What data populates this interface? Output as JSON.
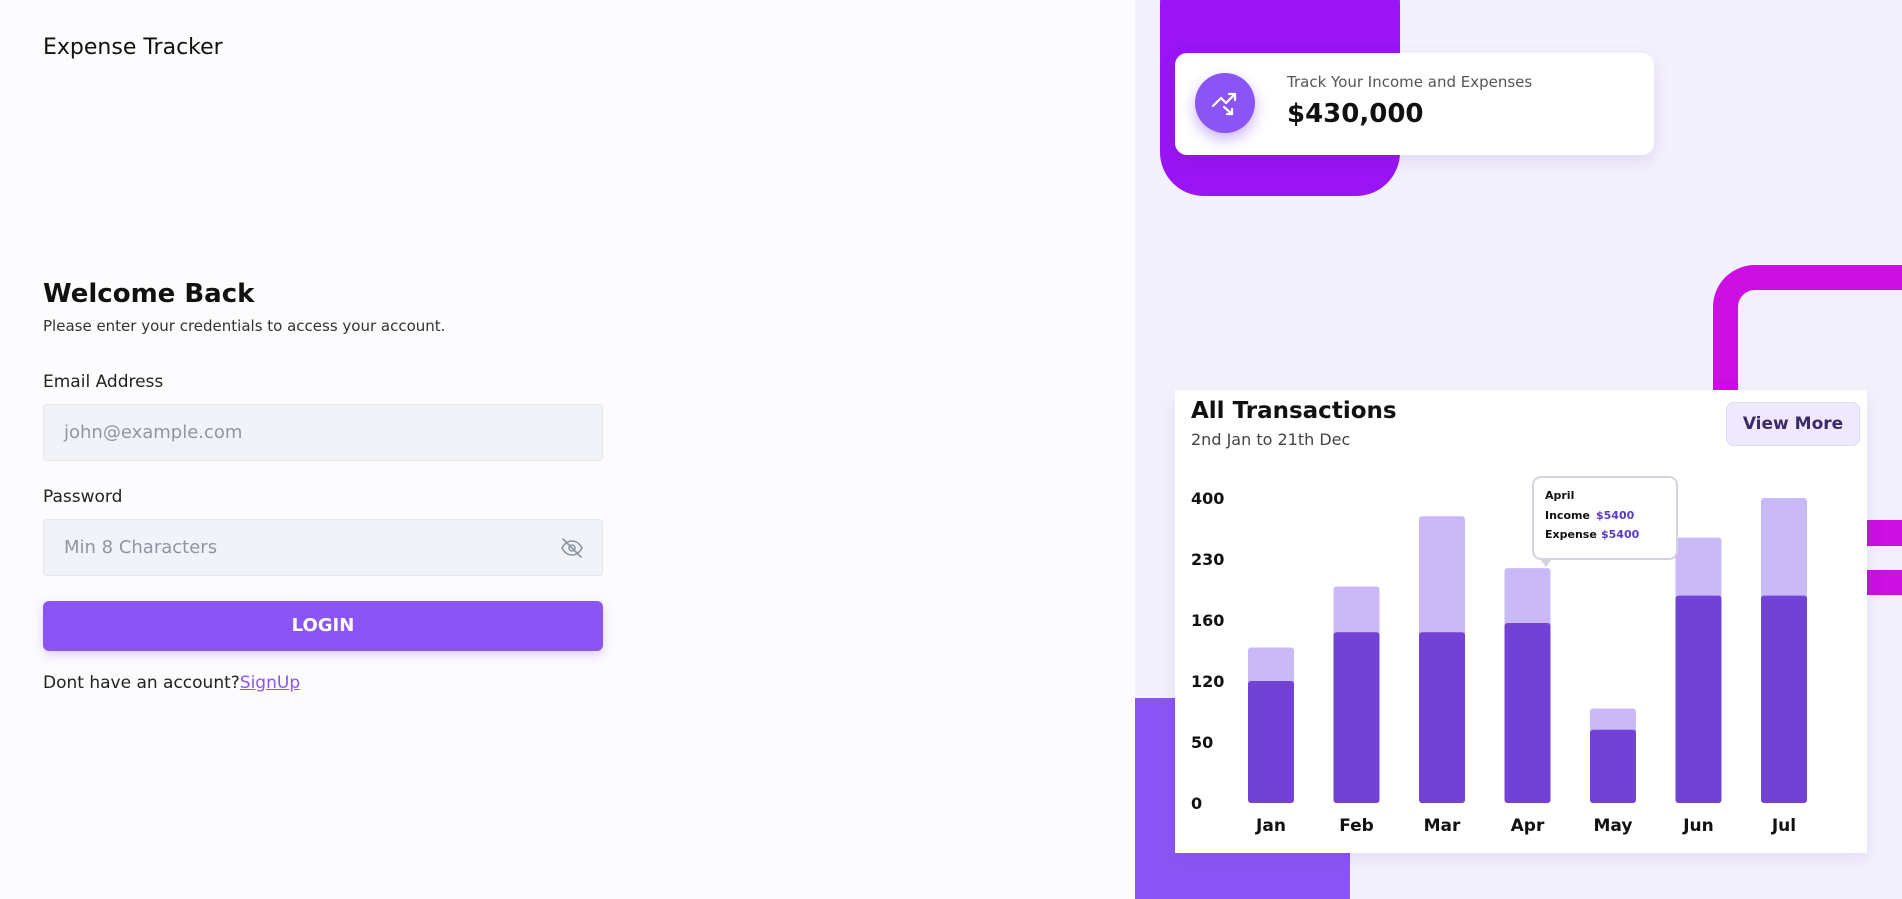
{
  "brand": {
    "title": "Expense Tracker"
  },
  "form": {
    "heading": "Welcome Back",
    "subtitle": "Please enter your credentials to access your account.",
    "email_label": "Email Address",
    "email_placeholder": "john@example.com",
    "password_label": "Password",
    "password_placeholder": "Min 8 Characters",
    "login_label": "LOGIN",
    "no_account_text": "Dont have an account?",
    "signup_label": "SignUp"
  },
  "summary_card": {
    "label": "Track Your Income and Expenses",
    "value": "$430,000",
    "icon": "trending-icon"
  },
  "chart_card": {
    "title": "All Transactions",
    "subtitle": "2nd Jan to 21th Dec",
    "view_more_label": "View More",
    "tooltip": {
      "month": "April",
      "income_label": "Income",
      "income_value": "$5400",
      "expense_label": "Expense",
      "expense_value": "$5400"
    }
  },
  "colors": {
    "accent": "#8b55f5",
    "dark_bar": "#7142d4",
    "light_bar": "#c9b9f6",
    "magenta": "#cc0fe3",
    "violet": "#9a14f5"
  },
  "chart_data": {
    "type": "bar",
    "categories": [
      "Jan",
      "Feb",
      "Mar",
      "Apr",
      "May",
      "Jun",
      "Jul"
    ],
    "y_tick_labels": [
      "0",
      "50",
      "120",
      "160",
      "230",
      "400"
    ],
    "series": [
      {
        "values": [
          2.0,
          2.8,
          2.8,
          2.95,
          1.2,
          3.4,
          3.4
        ]
      },
      {
        "values": [
          2.55,
          3.55,
          4.7,
          3.85,
          1.55,
          4.35,
          5.0
        ]
      }
    ]
  }
}
